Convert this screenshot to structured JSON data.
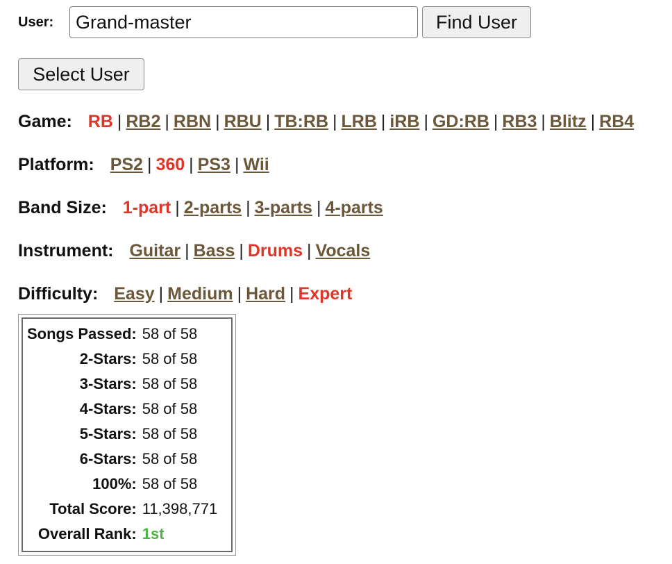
{
  "user_search": {
    "label": "User:",
    "value": "Grand-master",
    "find_button": "Find User",
    "select_button": "Select User"
  },
  "filters": {
    "game": {
      "label": "Game:",
      "options": [
        {
          "text": "RB",
          "active": true
        },
        {
          "text": "RB2",
          "active": false
        },
        {
          "text": "RBN",
          "active": false
        },
        {
          "text": "RBU",
          "active": false
        },
        {
          "text": "TB:RB",
          "active": false
        },
        {
          "text": "LRB",
          "active": false
        },
        {
          "text": "iRB",
          "active": false
        },
        {
          "text": "GD:RB",
          "active": false
        },
        {
          "text": "RB3",
          "active": false
        },
        {
          "text": "Blitz",
          "active": false
        },
        {
          "text": "RB4",
          "active": false
        }
      ]
    },
    "platform": {
      "label": "Platform:",
      "options": [
        {
          "text": "PS2",
          "active": false
        },
        {
          "text": "360",
          "active": true
        },
        {
          "text": "PS3",
          "active": false
        },
        {
          "text": "Wii",
          "active": false
        }
      ]
    },
    "band_size": {
      "label": "Band Size:",
      "options": [
        {
          "text": "1-part",
          "active": true
        },
        {
          "text": "2-parts",
          "active": false
        },
        {
          "text": "3-parts",
          "active": false
        },
        {
          "text": "4-parts",
          "active": false
        }
      ]
    },
    "instrument": {
      "label": "Instrument:",
      "options": [
        {
          "text": "Guitar",
          "active": false
        },
        {
          "text": "Bass",
          "active": false
        },
        {
          "text": "Drums",
          "active": true
        },
        {
          "text": "Vocals",
          "active": false
        }
      ]
    },
    "difficulty": {
      "label": "Difficulty:",
      "options": [
        {
          "text": "Easy",
          "active": false
        },
        {
          "text": "Medium",
          "active": false
        },
        {
          "text": "Hard",
          "active": false
        },
        {
          "text": "Expert",
          "active": true
        }
      ]
    }
  },
  "stats": {
    "songs_passed": {
      "label": "Songs Passed:",
      "value": "58 of 58"
    },
    "two_stars": {
      "label": "2-Stars:",
      "value": "58 of 58"
    },
    "three_stars": {
      "label": "3-Stars:",
      "value": "58 of 58"
    },
    "four_stars": {
      "label": "4-Stars:",
      "value": "58 of 58"
    },
    "five_stars": {
      "label": "5-Stars:",
      "value": "58 of 58"
    },
    "six_stars": {
      "label": "6-Stars:",
      "value": "58 of 58"
    },
    "hundred_percent": {
      "label": "100%:",
      "value": "58 of 58"
    },
    "total_score": {
      "label": "Total Score:",
      "value": "11,398,771"
    },
    "overall_rank": {
      "label": "Overall Rank:",
      "value": "1st"
    }
  },
  "colors": {
    "active_option": "#e0362a",
    "link_option": "#6b573a",
    "rank": "#4cb444"
  }
}
